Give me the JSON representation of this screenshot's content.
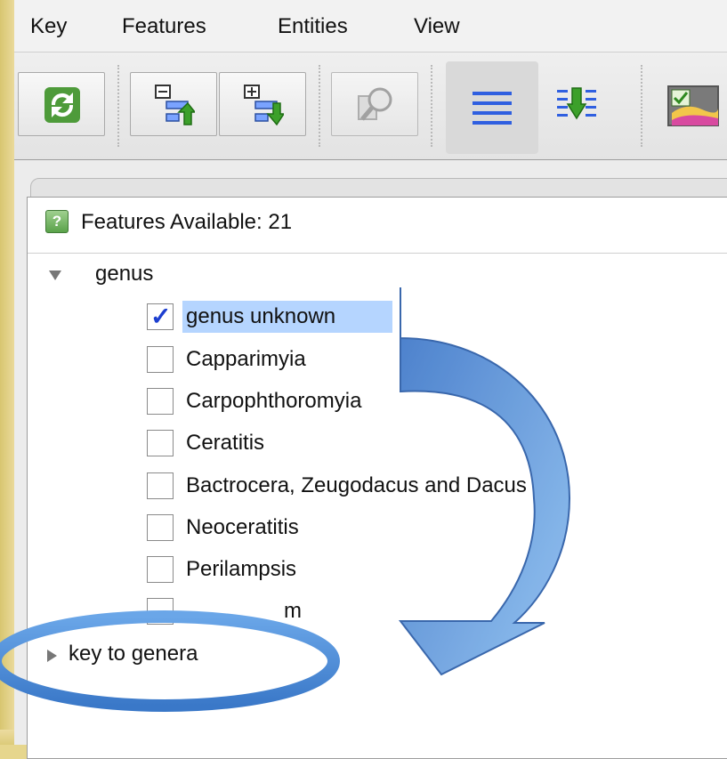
{
  "menu": {
    "items": [
      {
        "label": "Key"
      },
      {
        "label": "Features"
      },
      {
        "label": "Entities"
      },
      {
        "label": "View"
      }
    ]
  },
  "toolbar": {
    "buttons": [
      {
        "icon": "refresh-icon"
      },
      {
        "icon": "collapse-up-icon"
      },
      {
        "icon": "expand-down-icon"
      },
      {
        "icon": "search-feature-icon"
      },
      {
        "icon": "list-view-icon"
      },
      {
        "icon": "sorted-list-icon"
      },
      {
        "icon": "image-check-icon"
      }
    ]
  },
  "panel": {
    "header_label": "Features Available: 21",
    "header_icon": "?",
    "tree": {
      "genus": {
        "label": "genus",
        "options": [
          {
            "label": "genus unknown",
            "checked": true
          },
          {
            "label": "Capparimyia",
            "checked": false
          },
          {
            "label": "Carpophthoromyia",
            "checked": false
          },
          {
            "label": "Ceratitis",
            "checked": false
          },
          {
            "label": "Bactrocera, Zeugodacus and Dacus",
            "checked": false
          },
          {
            "label": "Neoceratitis",
            "checked": false
          },
          {
            "label": "Perilampsis",
            "checked": false
          },
          {
            "label": "m",
            "checked": false
          }
        ]
      },
      "key_to_genera": {
        "label": "key to genera"
      }
    }
  },
  "colors": {
    "selection": "#b5d5ff",
    "check": "#1d3fd0",
    "arrow": "#4a8ad6",
    "highlight_ring": "#4a8ad6"
  }
}
